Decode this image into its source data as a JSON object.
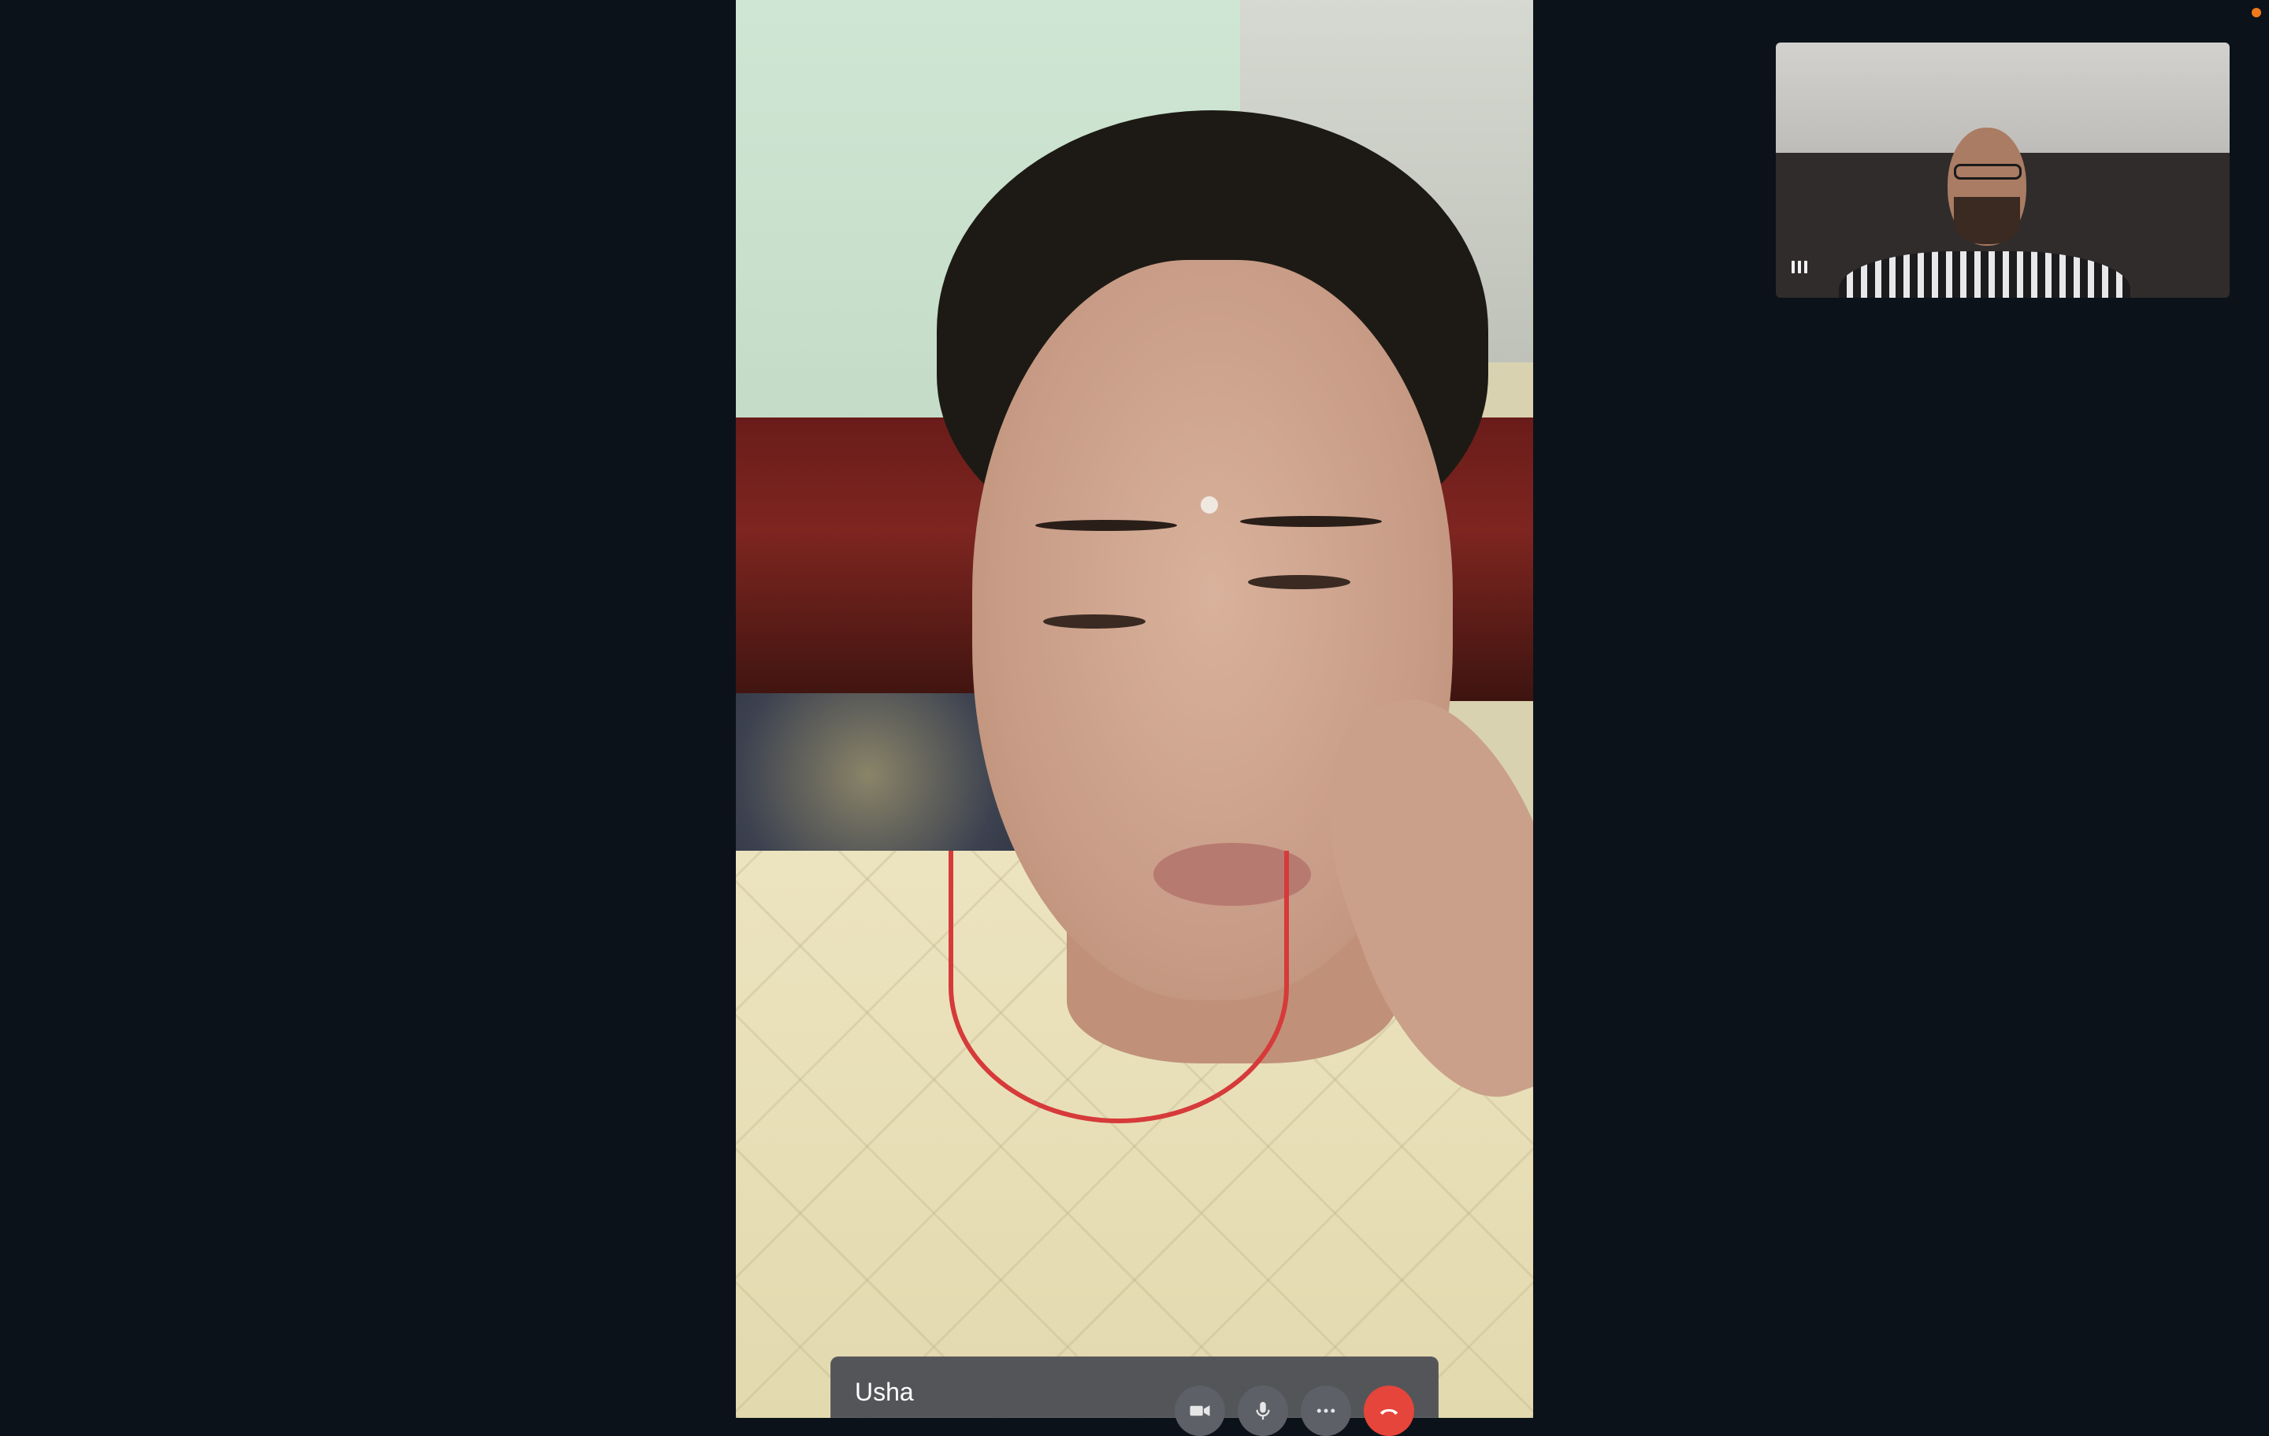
{
  "call": {
    "caller_name": "Usha"
  },
  "colors": {
    "end_call": "#e5453a",
    "status_dot": "#f07a1a",
    "background": "#0c121a"
  },
  "icons": {
    "camera": "video-camera-icon",
    "mic": "microphone-icon",
    "more": "more-options-icon",
    "end": "end-call-icon",
    "audio": "audio-level-icon"
  }
}
